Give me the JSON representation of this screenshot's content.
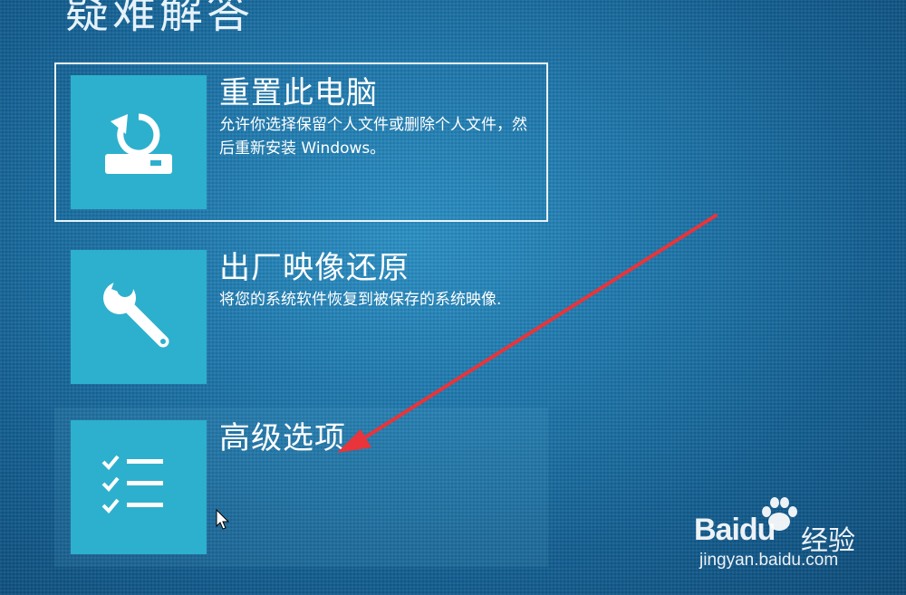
{
  "page": {
    "title": "疑难解答"
  },
  "options": [
    {
      "title": "重置此电脑",
      "description": "允许你选择保留个人文件或删除个人文件，然后重新安装 Windows。",
      "icon": "reset-pc-icon"
    },
    {
      "title": "出厂映像还原",
      "description": "将您的系统软件恢复到被保存的系统映像.",
      "icon": "wrench-icon"
    },
    {
      "title": "高级选项",
      "description": "",
      "icon": "checklist-icon"
    }
  ],
  "watermark": {
    "brand": "Baidu",
    "label": "经验",
    "url": "jingyan.baidu.com"
  },
  "colors": {
    "background": "#1d77ab",
    "tile": "#2db0cd",
    "arrow": "#e8343a",
    "text": "#ffffff"
  }
}
